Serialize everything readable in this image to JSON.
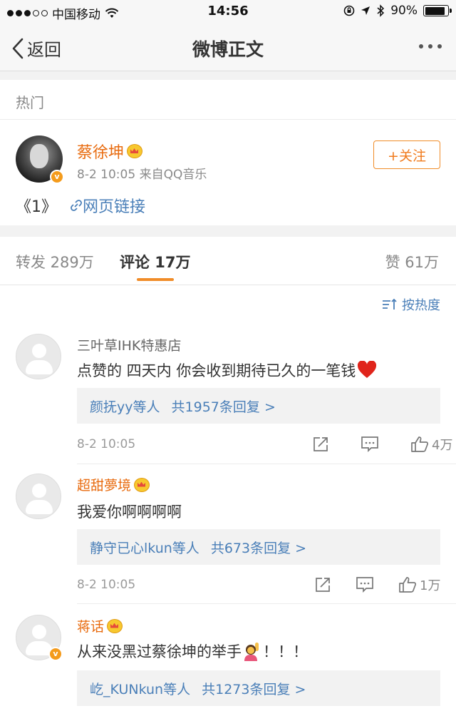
{
  "status": {
    "carrier": "中国移动",
    "time": "14:56",
    "battery": "90%",
    "battery_level": 0.9
  },
  "nav": {
    "back_label": "返回",
    "title": "微博正文"
  },
  "section_label": "热门",
  "post": {
    "author": "蔡徐坤",
    "meta": "8-2 10:05  来自QQ音乐",
    "follow_label": "+关注",
    "content_text": "《1》",
    "link_label": "网页链接"
  },
  "tabs": {
    "reposts": "转发 289万",
    "comments": "评论 17万",
    "likes": "赞 61万"
  },
  "sort_label": "按热度",
  "comments": [
    {
      "name": "三叶草IHK特惠店",
      "text": "点赞的 四天内 你会收到期待已久的一笔钱",
      "reply_users": "颜抚yy等人",
      "reply_count": "共1957条回复 >",
      "time": "8-2 10:05",
      "likes": "4万"
    },
    {
      "name": "超甜夢境",
      "text": "我爱你啊啊啊啊",
      "reply_users": "静守已心lkun等人",
      "reply_count": "共673条回复 >",
      "time": "8-2 10:05",
      "likes": "1万"
    },
    {
      "name": "蒋话",
      "text": "从来没黑过蔡徐坤的举手",
      "text_suffix": "！！！",
      "reply_users": "屹_KUNkun等人",
      "reply_count": "共1273条回复 >"
    }
  ]
}
